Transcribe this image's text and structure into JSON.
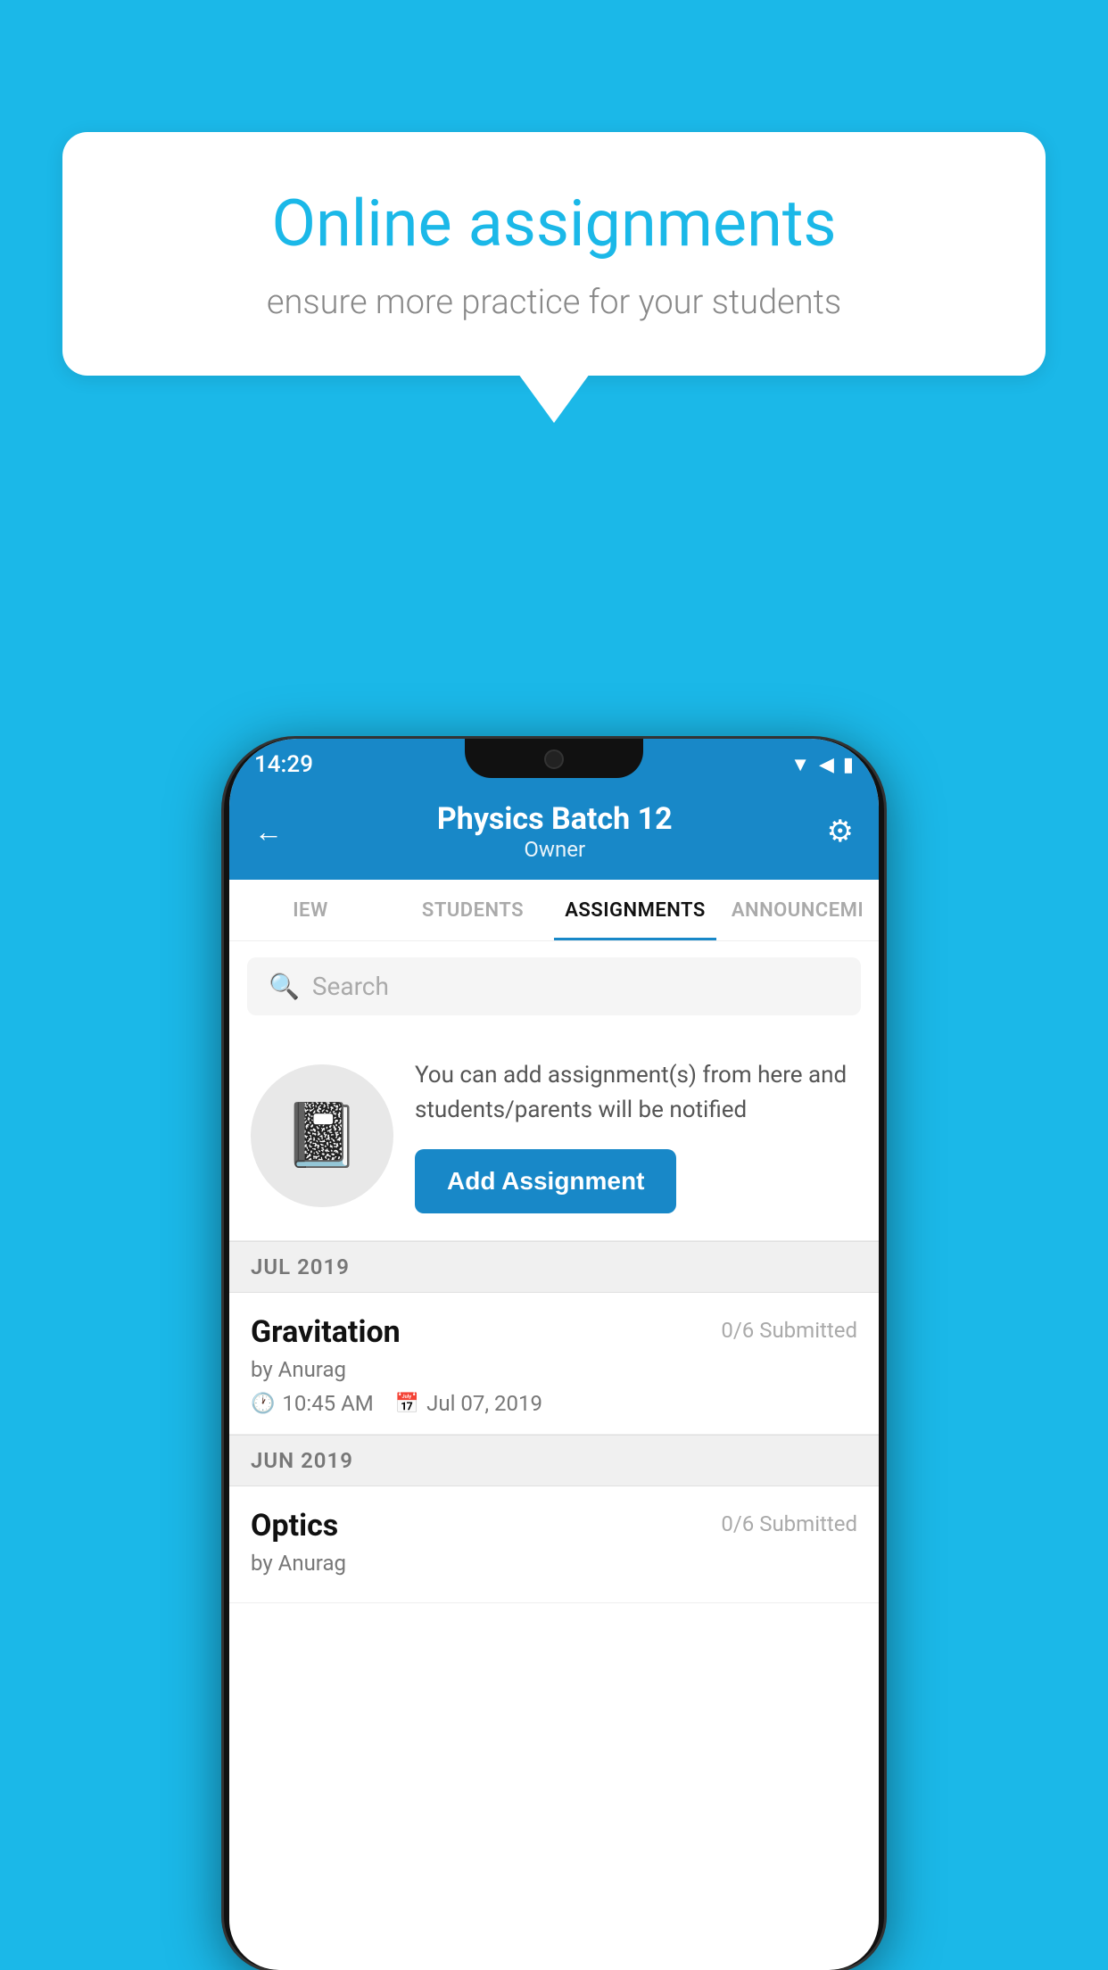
{
  "background_color": "#1BB8E8",
  "speech_bubble": {
    "title": "Online assignments",
    "subtitle": "ensure more practice for your students"
  },
  "status_bar": {
    "time": "14:29",
    "signal_icons": "▼◀▮"
  },
  "header": {
    "title": "Physics Batch 12",
    "subtitle": "Owner",
    "back_icon": "←",
    "gear_icon": "⚙"
  },
  "tabs": [
    {
      "label": "IEW",
      "active": false
    },
    {
      "label": "STUDENTS",
      "active": false
    },
    {
      "label": "ASSIGNMENTS",
      "active": true
    },
    {
      "label": "ANNOUNCEMI",
      "active": false
    }
  ],
  "search": {
    "placeholder": "Search"
  },
  "promo": {
    "description": "You can add assignment(s) from here and students/parents will be notified",
    "button_label": "Add Assignment"
  },
  "sections": [
    {
      "month_label": "JUL 2019",
      "assignments": [
        {
          "name": "Gravitation",
          "submitted": "0/6 Submitted",
          "by": "by Anurag",
          "time": "10:45 AM",
          "date": "Jul 07, 2019"
        }
      ]
    },
    {
      "month_label": "JUN 2019",
      "assignments": [
        {
          "name": "Optics",
          "submitted": "0/6 Submitted",
          "by": "by Anurag",
          "time": "",
          "date": ""
        }
      ]
    }
  ]
}
